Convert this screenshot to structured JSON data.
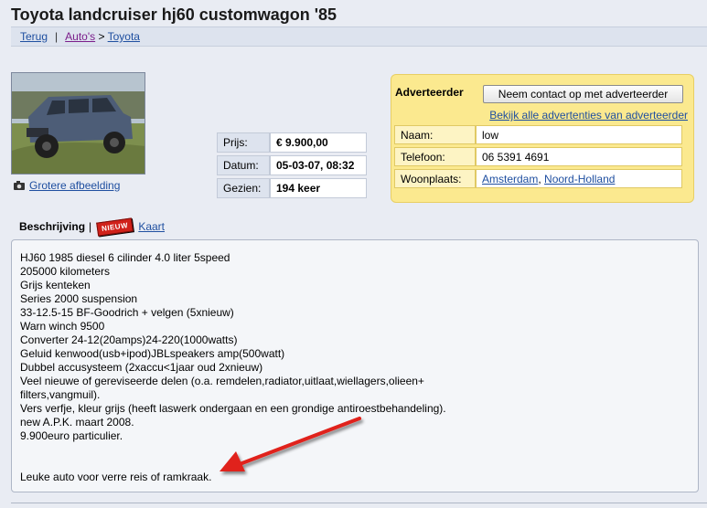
{
  "page": {
    "title": "Toyota landcruiser hj60 customwagon '85"
  },
  "breadcrumb": {
    "back": "Terug",
    "separator": "|",
    "category": "Auto's",
    "arrow": ">",
    "brand": "Toyota"
  },
  "photo": {
    "larger_link": "Grotere afbeelding",
    "icon": "camera-icon"
  },
  "details": [
    {
      "label": "Prijs:",
      "value": "€ 9.900,00"
    },
    {
      "label": "Datum:",
      "value": "05-03-07, 08:32"
    },
    {
      "label": "Gezien:",
      "value": "194 keer"
    }
  ],
  "advertiser": {
    "heading": "Adverteerder",
    "contact_button": "Neem contact op met adverteerder",
    "all_ads_link": "Bekijk alle advertenties van adverteerder",
    "name_label": "Naam:",
    "name": "low",
    "phone_label": "Telefoon:",
    "phone": "06 5391 4691",
    "city_label": "Woonplaats:",
    "city": "Amsterdam",
    "city_sep": ",",
    "province": "Noord-Holland"
  },
  "tabs": {
    "description": "Beschrijving",
    "separator": "|",
    "new_badge": "NIEUW",
    "map": "Kaart"
  },
  "description": {
    "lines": [
      "HJ60 1985 diesel 6 cilinder 4.0 liter 5speed",
      "205000 kilometers",
      "Grijs kenteken",
      "Series 2000 suspension",
      "33-12.5-15 BF-Goodrich + velgen (5xnieuw)",
      "Warn winch 9500",
      "Converter 24-12(20amps)24-220(1000watts)",
      "Geluid kenwood(usb+ipod)JBLspeakers amp(500watt)",
      "Dubbel accusysteem (2xaccu<1jaar oud 2xnieuw)",
      "Veel nieuwe of gereviseerde delen (o.a. remdelen,radiator,uitlaat,wiellagers,olieen+",
      "filters,vangmuil).",
      "Vers verfje, kleur grijs (heeft laswerk ondergaan en een grondige antiroestbehandeling).",
      "new A.P.K. maart 2008.",
      "9.900euro particulier.",
      "",
      "",
      "Leuke auto voor verre reis of ramkraak."
    ]
  },
  "colors": {
    "link": "#1f4fa0",
    "visited_link": "#7a1d8a",
    "advertiser_bg": "#fbe98f",
    "arrow": "#e0201a"
  }
}
